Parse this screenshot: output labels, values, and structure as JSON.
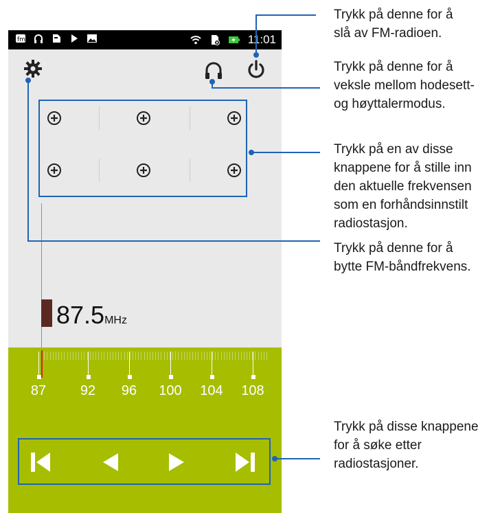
{
  "status_bar": {
    "time": "11:01",
    "icons_left": [
      "fm-notif-icon",
      "headset-notif-icon",
      "tag-icon",
      "play-icon",
      "image-icon"
    ],
    "icons_right": [
      "wifi-icon",
      "no-sim-icon",
      "battery-charging-icon"
    ]
  },
  "toolbar": {
    "settings_icon": "gear-icon",
    "audio_mode_icon": "headset-icon",
    "power_icon": "power-icon"
  },
  "presets": {
    "icon": "plus-circle-icon",
    "count": 6
  },
  "tuner": {
    "frequency": "87.5",
    "unit": "MHz"
  },
  "dial": {
    "labels": [
      "87",
      "92",
      "96",
      "100",
      "104",
      "108"
    ]
  },
  "controls": {
    "icons": [
      "skip-back-icon",
      "seek-back-icon",
      "seek-forward-icon",
      "skip-forward-icon"
    ]
  },
  "callouts": {
    "power": "Trykk på denne for å\nslå av FM-radioen.",
    "headset": "Trykk på denne for å\nveksle mellom hodesett-\nog høyttalermodus.",
    "presets": "Trykk på en av disse\nknappene for å stille inn\nden aktuelle frekvensen\nsom en forhåndsinnstilt\nradiostasjon.",
    "settings": "Trykk på denne for å\nbytte FM-båndfrekvens.",
    "seek": "Trykk på disse knappene\nfor å søke etter\nradiostasjoner."
  },
  "colors": {
    "dial_background": "#a6bd00",
    "callout_line": "#1e64b4",
    "marker": "#5a2a22",
    "needle_active": "#d42020"
  }
}
